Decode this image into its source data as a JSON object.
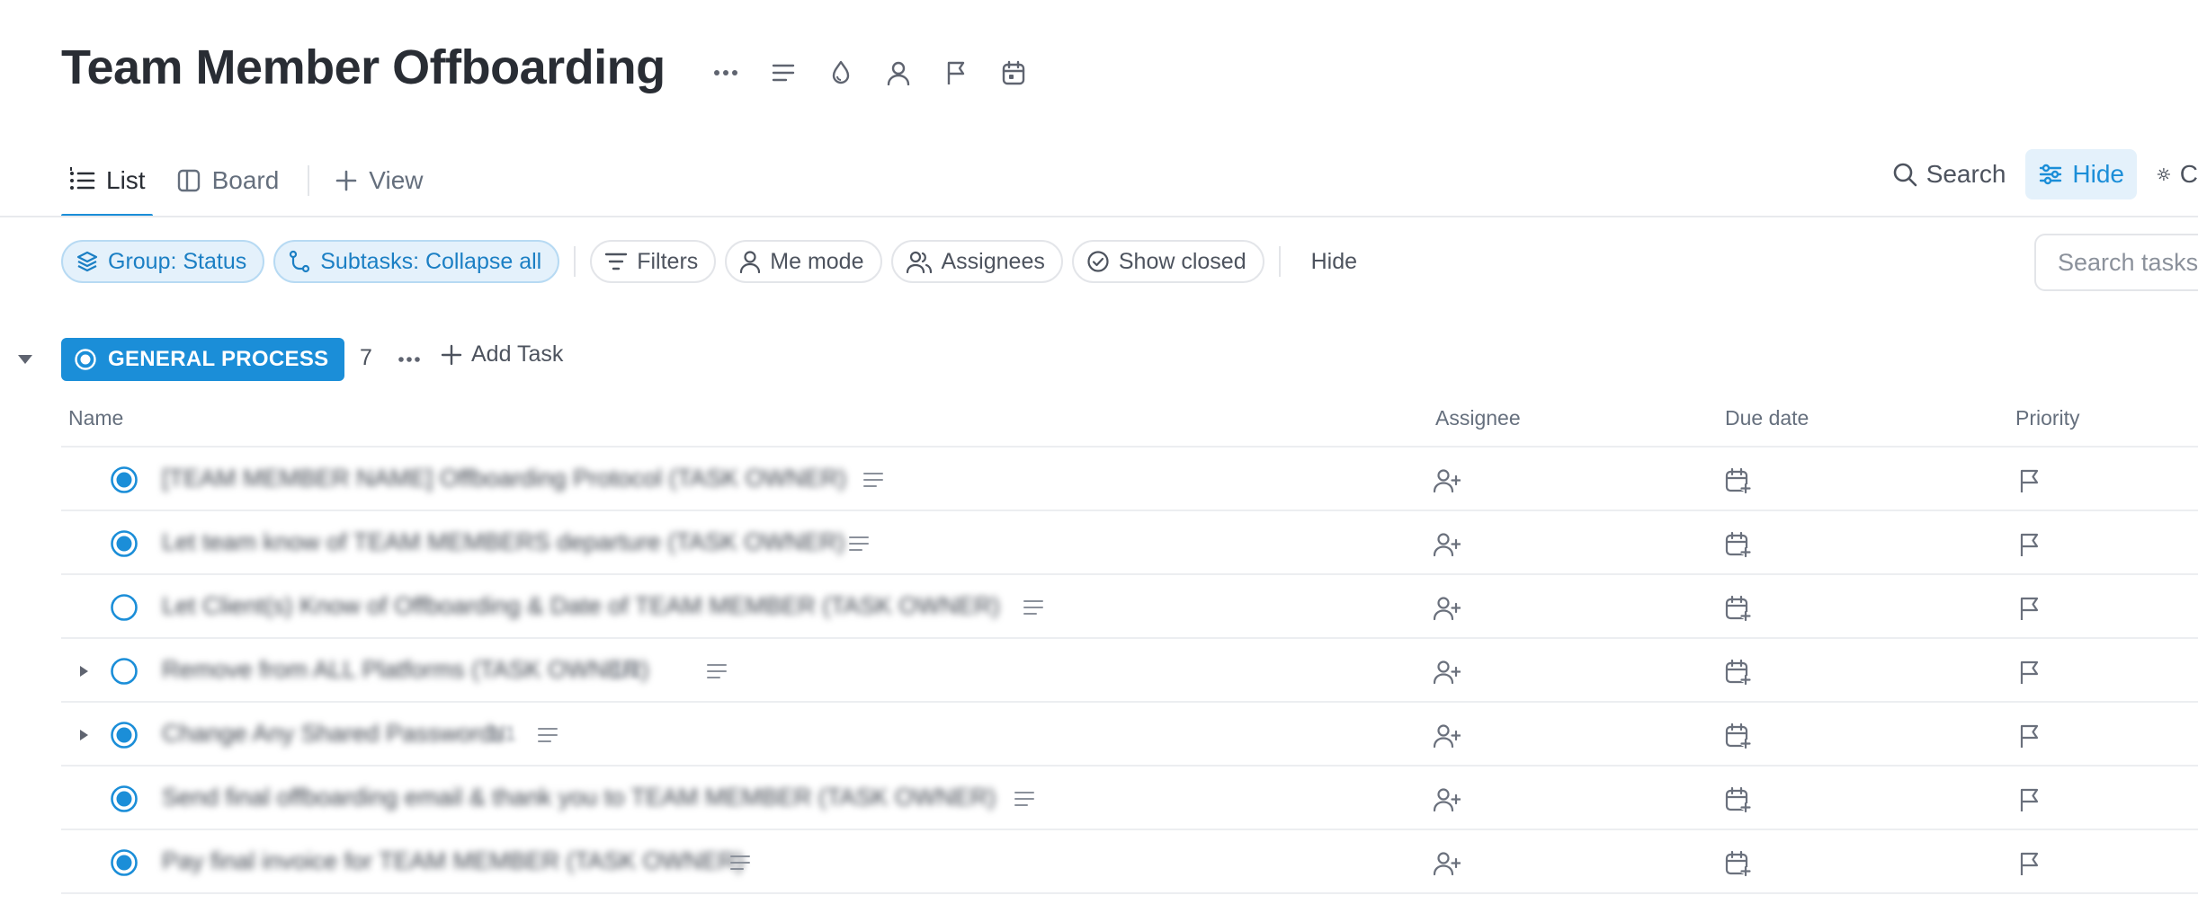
{
  "header": {
    "title": "Team Member Offboarding"
  },
  "tabs": [
    {
      "label": "List",
      "active": true
    },
    {
      "label": "Board",
      "active": false
    },
    {
      "label": "View",
      "active": false
    }
  ],
  "right_actions": {
    "search": "Search",
    "hide": "Hide",
    "customize": "C"
  },
  "filters": {
    "group": "Group: Status",
    "subtasks": "Subtasks: Collapse all",
    "filters": "Filters",
    "me_mode": "Me mode",
    "assignees": "Assignees",
    "show_closed": "Show closed",
    "hide": "Hide",
    "search_placeholder": "Search tasks"
  },
  "group": {
    "status": "GENERAL PROCESS",
    "count": "7",
    "add_task": "Add Task"
  },
  "columns": {
    "name": "Name",
    "assignee": "Assignee",
    "due_date": "Due date",
    "priority": "Priority"
  },
  "tasks": [
    {
      "name": "[TEAM MEMBER NAME] Offboarding Protocol (TASK OWNER)",
      "done": true,
      "has_subtasks": false
    },
    {
      "name": "Let team know of TEAM MEMBERS departure (TASK OWNER)",
      "done": true,
      "has_subtasks": false
    },
    {
      "name": "Let Client(s) Know of Offboarding & Date of TEAM MEMBER (TASK OWNER)",
      "done": false,
      "has_subtasks": false
    },
    {
      "name": "Remove from ALL Platforms (TASK OWNER)",
      "done": false,
      "has_subtasks": true,
      "subtask_count": "1/1"
    },
    {
      "name": "Change Any Shared Passwords",
      "done": true,
      "has_subtasks": true,
      "subtask_count": "1/1"
    },
    {
      "name": "Send final offboarding email & thank you to TEAM MEMBER (TASK OWNER)",
      "done": true,
      "has_subtasks": false
    },
    {
      "name": "Pay final invoice for TEAM MEMBER (TASK OWNER)",
      "done": true,
      "has_subtasks": false
    }
  ],
  "colors": {
    "accent": "#1b8ed8",
    "accent_light": "#e4f1fb",
    "text": "#292d34",
    "muted": "#656f7d",
    "border": "#e3e5e9"
  }
}
